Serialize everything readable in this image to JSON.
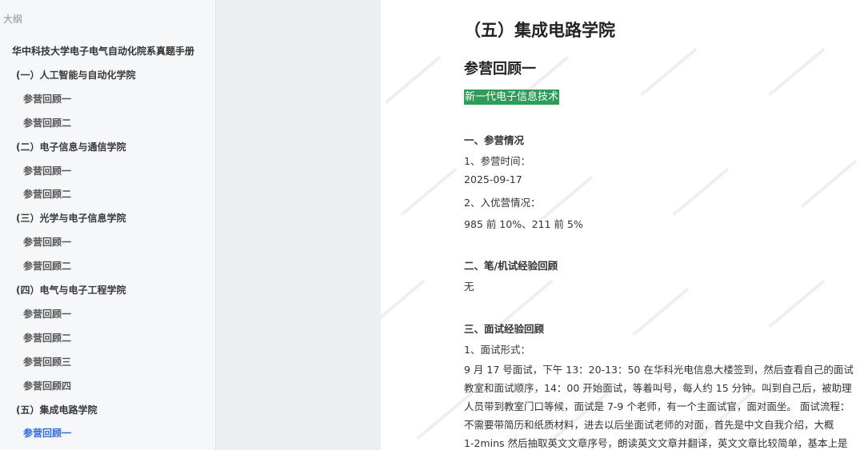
{
  "sidebar": {
    "outline_label": "大纲",
    "items": [
      {
        "label": "华中科技大学电子电气自动化院系真题手册",
        "level": 0,
        "active": false
      },
      {
        "label": "(一）人工智能与自动化学院",
        "level": 1,
        "active": false
      },
      {
        "label": "参营回顾一",
        "level": 2,
        "active": false
      },
      {
        "label": "参营回顾二",
        "level": 2,
        "active": false
      },
      {
        "label": "(二）电子信息与通信学院",
        "level": 1,
        "active": false
      },
      {
        "label": "参营回顾一",
        "level": 2,
        "active": false
      },
      {
        "label": "参营回顾二",
        "level": 2,
        "active": false
      },
      {
        "label": "(三）光学与电子信息学院",
        "level": 1,
        "active": false
      },
      {
        "label": "参营回顾一",
        "level": 2,
        "active": false
      },
      {
        "label": "参营回顾二",
        "level": 2,
        "active": false
      },
      {
        "label": "(四）电气与电子工程学院",
        "level": 1,
        "active": false
      },
      {
        "label": "参营回顾一",
        "level": 2,
        "active": false
      },
      {
        "label": "参营回顾二",
        "level": 2,
        "active": false
      },
      {
        "label": "参营回顾三",
        "level": 2,
        "active": false
      },
      {
        "label": "参营回顾四",
        "level": 2,
        "active": false
      },
      {
        "label": "(五）集成电路学院",
        "level": 1,
        "active": false
      },
      {
        "label": "参营回顾一",
        "level": 2,
        "active": true
      }
    ]
  },
  "document": {
    "college_title": "（五）集成电路学院",
    "section_title": "参营回顾一",
    "highlight_tag": "新一代电子信息技术",
    "s1_heading": "一、参营情况",
    "s1_item1_label": "1、参营时间：",
    "s1_item1_value": "2025-09-17",
    "s1_item2_label": "2、入优营情况：",
    "s1_item2_value": "985 前 10%、211 前 5%",
    "s2_heading": "二、笔/机试经验回顾",
    "s2_value": "无",
    "s3_heading": "三、面试经验回顾",
    "s3_item1_label": "1、面试形式：",
    "s3_paragraph_lines": [
      "9 月 17 号面试，下午 13：20-13：50 在华科光电信息大楼签到，然后查看自己的面试",
      "教室和面试顺序，14：00 开始面试，等着叫号，每人约 15 分钟。叫到自己后，被助理",
      "人员带到教室门口等候，面试是 7-9 个老师，有一个主面试官，面对面坐。 面试流程：",
      "不需要带简历和纸质材料，进去以后坐面试老师的对面，首先是中文自我介绍，大概",
      "1-2mins 然后抽取英文文章序号，朗读英文文章并翻译，英文文章比较简单，基本上是"
    ]
  },
  "colors": {
    "highlight_bg": "#2e9b58",
    "active_link": "#2f6bd8",
    "sidebar_bg": "#f6f7f9",
    "gutter_bg": "#eceef1"
  }
}
